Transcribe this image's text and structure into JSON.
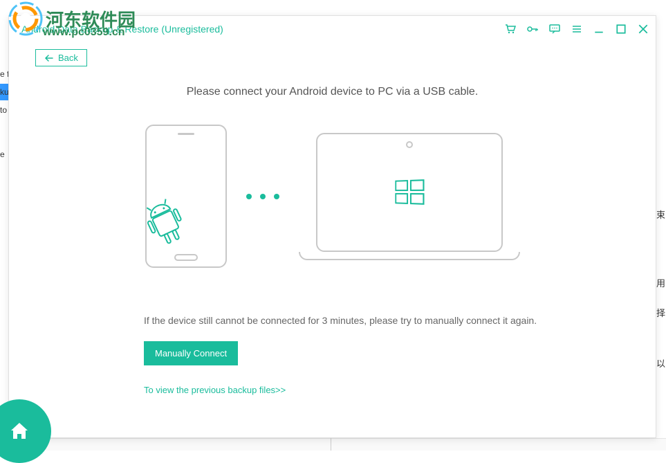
{
  "watermark": {
    "text": "河东软件园",
    "url": "www.pc0359.cn"
  },
  "titlebar": {
    "title": "Android Data Backup & Restore (Unregistered)",
    "icons": {
      "cart": "cart-icon",
      "key": "key-icon",
      "feedback": "feedback-icon",
      "menu": "menu-icon",
      "minimize": "minimize-icon",
      "maximize": "maximize-icon",
      "close": "close-icon"
    }
  },
  "back_button": {
    "label": "Back"
  },
  "main": {
    "instruction": "Please connect your Android device to PC via a USB cable.",
    "hint": "If the device still cannot be connected for 3 minutes, please try to manually connect it again.",
    "manual_connect_label": "Manually Connect",
    "view_previous_label": "To view the previous backup files>>"
  },
  "sidebar_fragments": [
    "e f",
    "ku",
    "to",
    "e"
  ],
  "right_fragments": [
    "束",
    "用",
    "择",
    "以"
  ],
  "colors": {
    "accent": "#1abc9c",
    "watermark": "#2e8b57"
  }
}
